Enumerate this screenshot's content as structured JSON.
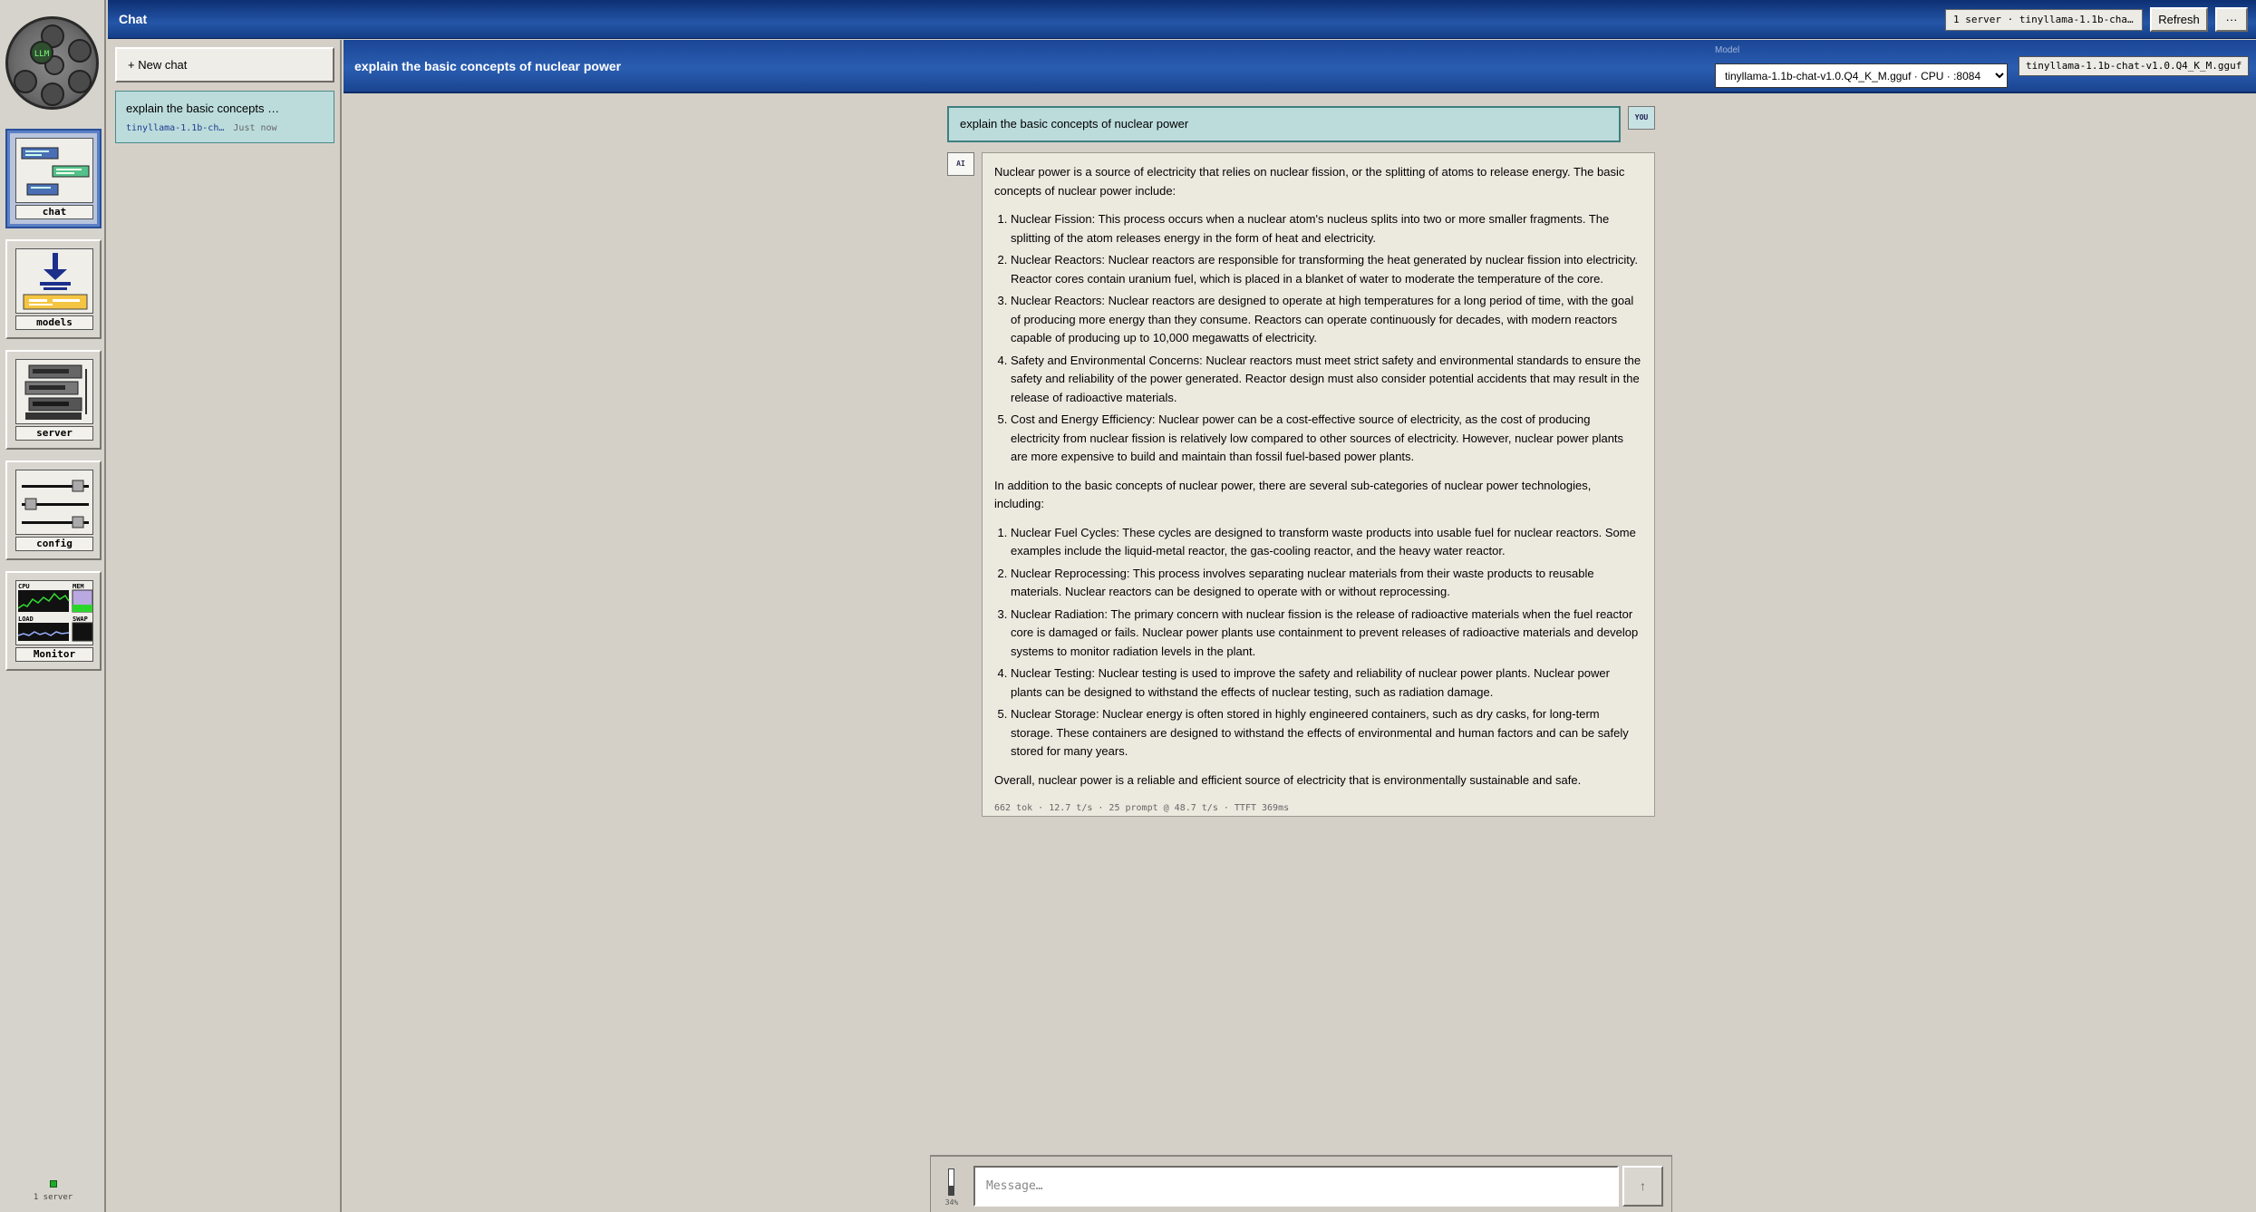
{
  "app": {
    "title": "Chat",
    "logo_text": "LLM"
  },
  "dock": {
    "items": [
      {
        "id": "chat",
        "label": "chat",
        "active": true
      },
      {
        "id": "models",
        "label": "models",
        "active": false
      },
      {
        "id": "server",
        "label": "server",
        "active": false
      },
      {
        "id": "config",
        "label": "config",
        "active": false
      },
      {
        "id": "monitor",
        "label": "Monitor",
        "active": false
      }
    ],
    "monitor_labels": {
      "cpu": "CPU",
      "mem": "MEM",
      "load": "LOAD",
      "swap": "SWAP"
    },
    "status_text": "1 server",
    "status_color": "#1faa2a"
  },
  "topbar": {
    "server_pill": "1 server · tinyllama-1.1b-cha…",
    "refresh_label": "Refresh",
    "more_label": "···"
  },
  "sidebar": {
    "new_chat_label": "+ New chat",
    "conversations": [
      {
        "title": "explain the basic concepts …",
        "model": "tinyllama-1.1b-ch…",
        "time": "Just now"
      }
    ]
  },
  "header": {
    "title": "explain the basic concepts of nuclear power",
    "model_label": "Model",
    "model_selected": "tinyllama-1.1b-chat-v1.0.Q4_K_M.gguf · CPU · :8084",
    "model_pill": "tinyllama-1.1b-chat-v1.0.Q4_K_M.gguf"
  },
  "messages": {
    "user_badge": "YOU",
    "user_text": "explain the basic concepts of nuclear power",
    "ai_badge": "AI",
    "ai_intro": "Nuclear power is a source of electricity that relies on nuclear fission, or the splitting of atoms to release energy. The basic concepts of nuclear power include:",
    "ai_list1": [
      "Nuclear Fission: This process occurs when a nuclear atom's nucleus splits into two or more smaller fragments. The splitting of the atom releases energy in the form of heat and electricity.",
      "Nuclear Reactors: Nuclear reactors are responsible for transforming the heat generated by nuclear fission into electricity. Reactor cores contain uranium fuel, which is placed in a blanket of water to moderate the temperature of the core.",
      "Nuclear Reactors: Nuclear reactors are designed to operate at high temperatures for a long period of time, with the goal of producing more energy than they consume. Reactors can operate continuously for decades, with modern reactors capable of producing up to 10,000 megawatts of electricity.",
      "Safety and Environmental Concerns: Nuclear reactors must meet strict safety and environmental standards to ensure the safety and reliability of the power generated. Reactor design must also consider potential accidents that may result in the release of radioactive materials.",
      "Cost and Energy Efficiency: Nuclear power can be a cost-effective source of electricity, as the cost of producing electricity from nuclear fission is relatively low compared to other sources of electricity. However, nuclear power plants are more expensive to build and maintain than fossil fuel-based power plants."
    ],
    "ai_middle": "In addition to the basic concepts of nuclear power, there are several sub-categories of nuclear power technologies, including:",
    "ai_list2": [
      "Nuclear Fuel Cycles: These cycles are designed to transform waste products into usable fuel for nuclear reactors. Some examples include the liquid-metal reactor, the gas-cooling reactor, and the heavy water reactor.",
      "Nuclear Reprocessing: This process involves separating nuclear materials from their waste products to reusable materials. Nuclear reactors can be designed to operate with or without reprocessing.",
      "Nuclear Radiation: The primary concern with nuclear fission is the release of radioactive materials when the fuel reactor core is damaged or fails. Nuclear power plants use containment to prevent releases of radioactive materials and develop systems to monitor radiation levels in the plant.",
      "Nuclear Testing: Nuclear testing is used to improve the safety and reliability of nuclear power plants. Nuclear power plants can be designed to withstand the effects of nuclear testing, such as radiation damage.",
      "Nuclear Storage: Nuclear energy is often stored in highly engineered containers, such as dry casks, for long-term storage. These containers are designed to withstand the effects of environmental and human factors and can be safely stored for many years."
    ],
    "ai_conclusion": "Overall, nuclear power is a reliable and efficient source of electricity that is environmentally sustainable and safe.",
    "ai_stats": "662 tok · 12.7 t/s · 25 prompt @ 48.7 t/s · TTFT 369ms"
  },
  "composer": {
    "placeholder": "Message…",
    "context_fraction": 0.34,
    "context_label": "34%",
    "send_label": "↑"
  },
  "colors": {
    "title_bar": "#1b4696",
    "user_bubble": "#bcdcdc",
    "ai_bubble": "#ece9df",
    "active_dock": "#b8c4dc"
  }
}
